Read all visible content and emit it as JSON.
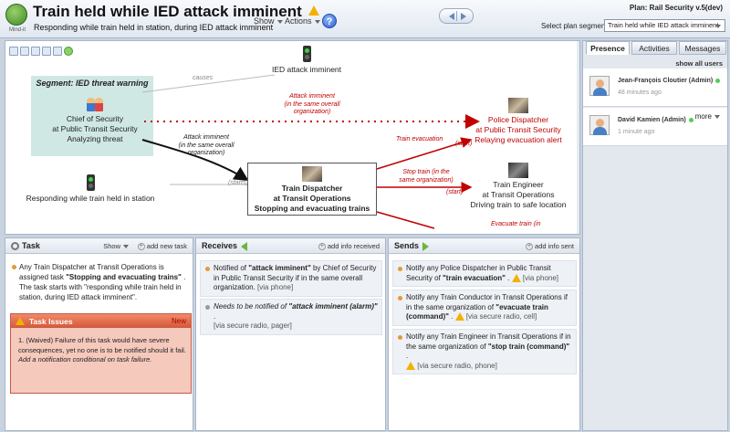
{
  "header": {
    "logo_text": "Mind-it",
    "title": "Train held while IED attack imminent",
    "subtitle": "Responding while train held in station, during IED attack imminent",
    "menu_show": "Show",
    "menu_actions": "Actions",
    "help_label": "?",
    "plan_label": "Plan: Rail Security v.5(dev)",
    "segment_label": "Select plan segment:",
    "segment_value": "Train held while IED attack imminent"
  },
  "flow": {
    "segment_box_title": "Segment: IED threat warning",
    "chief": [
      "Chief of Security",
      "at Public Transit Security",
      "Analyzing threat"
    ],
    "ied_event": "IED attack imminent",
    "responding_event": "Responding while train held in station",
    "dispatcher": [
      "Train Dispatcher",
      "at Transit Operations",
      "Stopping and evacuating trains"
    ],
    "police": [
      "Police Dispatcher",
      "at Public Transit Security",
      "Relaying evacuation alert"
    ],
    "engineer": [
      "Train Engineer",
      "at Transit Operations",
      "Driving train to safe location"
    ],
    "lbl_causes": "causes",
    "lbl_attack_red": [
      "Attack imminent",
      "(in the same overall",
      "organization)"
    ],
    "lbl_attack_black": [
      "Attack imminent",
      "(in the same overall",
      "organization)"
    ],
    "lbl_starts": "(starts)",
    "lbl_train_evac": "Train evacuation",
    "lbl_start1": "(start)",
    "lbl_stop_train": [
      "Stop train (in the",
      "same organization)"
    ],
    "lbl_start2": "(start)",
    "lbl_evacuate_partial": "Evacuate train (in"
  },
  "presence": {
    "tabs": [
      "Presence",
      "Activities",
      "Messages"
    ],
    "show_all": "show all users",
    "users": [
      {
        "name": "Jean-François Cloutier (Admin)",
        "time": "48 minutes ago"
      },
      {
        "name": "David Kamien (Admin)",
        "time": "1 minute ago",
        "more": "more"
      }
    ]
  },
  "task": {
    "title": "Task",
    "show": "Show",
    "add": "add new task",
    "description_parts": [
      "Any Train Dispatcher at Transit Operations is assigned task ",
      "\"Stopping and evacuating trains\"",
      " . The task starts with \"responding while train held in station, during IED attack imminent\"."
    ],
    "issues_title": "Task Issues",
    "issues_new": "New",
    "issue_text": "1.  (Waived) Failure of this task would have severe consequences, yet no one is to be notified should it fail.",
    "issue_fix": "Add a notification conditional on task failure."
  },
  "receives": {
    "title": "Receives",
    "add": "add info received",
    "items": [
      {
        "a": "Notified of ",
        "b": "\"attack imminent\"",
        "c": " by Chief of Security in Public Transit Security if in the same overall organization.",
        "via": "[via phone]"
      },
      {
        "a": "Needs to be notified of ",
        "b": "\"attack imminent (alarm)\"",
        "c": " .",
        "via": "[via secure radio, pager]"
      }
    ]
  },
  "sends": {
    "title": "Sends",
    "add": "add info sent",
    "items": [
      {
        "a": "Notify any Police Dispatcher in Public Transit Security of ",
        "b": "\"train evacuation\"",
        "c": " .",
        "via": "[via phone]"
      },
      {
        "a": "Notify any Train Conductor in Transit Operations if in the same organization of ",
        "b": "\"evacuate train (command)\"",
        "c": " .",
        "via": "[via secure radio, cell]"
      },
      {
        "a": "Notify any Train Engineer in Transit Operations if in the same organization of ",
        "b": "\"stop train (command)\"",
        "c": " .",
        "via": "[via secure radio, phone]"
      }
    ]
  },
  "colors": {
    "accent_red": "#c00000",
    "segment_fill": "#cfe8e4",
    "issue_header": "#d85a3a"
  }
}
